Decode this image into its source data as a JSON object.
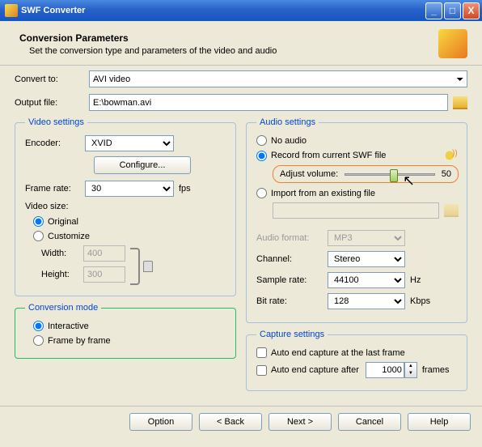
{
  "window": {
    "title": "SWF Converter"
  },
  "header": {
    "title": "Conversion Parameters",
    "subtitle": "Set the conversion type and parameters of the video and audio"
  },
  "convert": {
    "label": "Convert to:",
    "value": "AVI video"
  },
  "output": {
    "label": "Output file:",
    "value": "E:\\bowman.avi"
  },
  "video": {
    "legend": "Video settings",
    "encoder_label": "Encoder:",
    "encoder_value": "XVID",
    "configure_label": "Configure...",
    "framerate_label": "Frame rate:",
    "framerate_value": "30",
    "framerate_unit": "fps",
    "size_label": "Video size:",
    "original_label": "Original",
    "customize_label": "Customize",
    "width_label": "Width:",
    "width_value": "400",
    "height_label": "Height:",
    "height_value": "300"
  },
  "audio": {
    "legend": "Audio settings",
    "no_audio": "No audio",
    "record": "Record from current SWF file",
    "adjust_volume": "Adjust volume:",
    "volume_value": "50",
    "import": "Import from an existing file",
    "format_label": "Audio format:",
    "format_value": "MP3",
    "channel_label": "Channel:",
    "channel_value": "Stereo",
    "sample_label": "Sample rate:",
    "sample_value": "44100",
    "sample_unit": "Hz",
    "bitrate_label": "Bit rate:",
    "bitrate_value": "128",
    "bitrate_unit": "Kbps"
  },
  "mode": {
    "legend": "Conversion mode",
    "interactive": "Interactive",
    "fbf": "Frame by frame"
  },
  "capture": {
    "legend": "Capture settings",
    "auto_last": "Auto end capture at the last frame",
    "auto_after": "Auto end capture after",
    "after_value": "1000",
    "after_unit": "frames"
  },
  "footer": {
    "option": "Option",
    "back": "< Back",
    "next": "Next >",
    "cancel": "Cancel",
    "help": "Help"
  }
}
